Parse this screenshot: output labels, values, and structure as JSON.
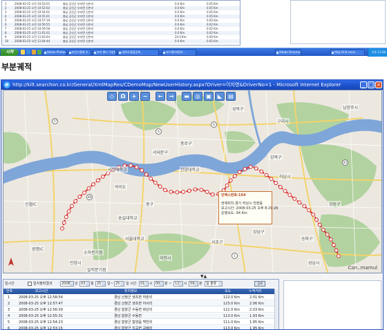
{
  "prev_screenshot": {
    "rows": [
      {
        "no": "1",
        "time": "2008-03-25 오전 10:52:01",
        "place": "충남 공산군 부리면 신촌리",
        "speed": "0.0 Km",
        "dist": "0.05 Km"
      },
      {
        "no": "2",
        "time": "2008-03-25 오전 10:52:03",
        "place": "충남 공산군 부리면 신촌리",
        "speed": "0.0 Km",
        "dist": "0.05 Km"
      },
      {
        "no": "3",
        "time": "2008-03-25 오전 10:54:01",
        "place": "충남 공산군 부리면 신촌리",
        "speed": "0.0 Km",
        "dist": "0.05 Km"
      },
      {
        "no": "4",
        "time": "2008-03-25 오전 10:55:01",
        "place": "충남 공산군 부리면 신촌리",
        "speed": "0.0 Km",
        "dist": "0.05 Km"
      },
      {
        "no": "5",
        "time": "2008-03-25 오전 10:57:19",
        "place": "충남 공산군 부리면 신촌리",
        "speed": "0.0 Km",
        "dist": "0.05 Km"
      },
      {
        "no": "6",
        "time": "2008-03-25 오전 10:56:55",
        "place": "충남 공산군 부리면 신촌리",
        "speed": "0.0 Km",
        "dist": "0.02 Km"
      },
      {
        "no": "7",
        "time": "2008-03-25 오전 10:59:58",
        "place": "충남 공산군 부리면 신촌리",
        "speed": "0.0 Km",
        "dist": "0.02 Km"
      },
      {
        "no": "8",
        "time": "2008-03-25 오전 11:01:01",
        "place": "충남 공산군 부리면 신촌리",
        "speed": "0.0 Km",
        "dist": "0.02 Km"
      },
      {
        "no": "9",
        "time": "2008-03-25 오전 11:03:44",
        "place": "충남 공산군 부리면 신촌리",
        "speed": "24.0 Km",
        "dist": "0.00 Km"
      },
      {
        "no": "10",
        "time": "2008-03-25 오전 11:04:44",
        "place": "충남 공산군 부리면 신촌리",
        "speed": "0.0 Km",
        "dist": "0.05 Km"
      }
    ],
    "taskbar": {
      "start": "시작",
      "tasks": [
        "Adobe Photosh...",
        "마인드맵에 오...",
        "프리 핸드 이상형...",
        "네이버 통합검색...",
        "코드웨어4정보...",
        "Adobe Dreamw...",
        "http://kilt.searc..."
      ],
      "clock": "오후 11:56"
    }
  },
  "section_heading": "부분궤적",
  "window": {
    "title": "http://kilt.searchon.co.kr/General/XmlMapRes/CDemoMap/NewUserHistory.aspx?Driver=이지영&DriverNo=1 - Microsoft Internet Explorer",
    "buttons": {
      "minimize": "_",
      "maximize": "□",
      "close": "×"
    }
  },
  "map": {
    "toolbar": [
      "◇",
      "Ω",
      "+",
      "−",
      "←",
      "→",
      "▬",
      "◎",
      "▣",
      "◣",
      "▤"
    ],
    "districts": [
      {
        "id": "gangbuk",
        "name": "강북구"
      },
      {
        "id": "dobong",
        "name": "성북구"
      },
      {
        "id": "seodaemun",
        "name": "서대문구"
      },
      {
        "id": "jongno",
        "name": "종로구"
      },
      {
        "id": "jung",
        "name": "중구"
      },
      {
        "id": "yeongdeungpo",
        "name": "여의도"
      },
      {
        "id": "gangnam",
        "name": "강남구"
      },
      {
        "id": "songpa",
        "name": "송파구"
      },
      {
        "id": "gangdong",
        "name": "강동구"
      },
      {
        "id": "guri",
        "name": "구리시"
      },
      {
        "id": "namyangju",
        "name": "남양주시"
      },
      {
        "id": "gwacheon",
        "name": "과천시"
      },
      {
        "id": "seongnam",
        "name": "성남시"
      },
      {
        "id": "hanam",
        "name": "하남시"
      },
      {
        "id": "seocho",
        "name": "서초구"
      },
      {
        "id": "anyang",
        "name": "안양시"
      },
      {
        "id": "hanyang",
        "name": "한양대학교"
      },
      {
        "id": "yonsei",
        "name": "서강대학교"
      },
      {
        "id": "soongsil",
        "name": "숭실대학교"
      },
      {
        "id": "seoul_univ",
        "name": "서울대학교"
      },
      {
        "id": "gimpo",
        "name": "신월IC"
      },
      {
        "id": "gongham",
        "name": "광명IC"
      },
      {
        "id": "sochon",
        "name": "소하분기점"
      },
      {
        "id": "ilsan",
        "name": "일직분기점"
      }
    ],
    "info_popup": {
      "title": "인덱스번호:154",
      "lines": [
        "현재위치:경기 하남시 천현동",
        "보고시간: 2008-03-25 오후 8:29:26",
        "운행속도: 94 Km"
      ]
    },
    "copyright": "Con..mamul",
    "expand_arrow": "▼▲"
  },
  "history": {
    "filter": {
      "label_start": "일시간",
      "checkbox_label": "일지출력결과",
      "year": "2008",
      "year_unit": "년",
      "month": "03",
      "month_unit": "월",
      "day": "25",
      "day_unit": "일",
      "to_label": "일~",
      "to_month": "25",
      "to_day_label": "일 시간",
      "hour1": "01",
      "hour1_unit": "시",
      "hour2": "00",
      "hour2_unit": "분 ~",
      "hour3": "12",
      "min3": "59",
      "min3_unit": "분",
      "mode": "일 분류",
      "search": "검색"
    },
    "columns": [
      "번호",
      "보고시간",
      "위치정보",
      "속도",
      "누적거리"
    ],
    "rows": [
      {
        "no": "1",
        "time": "2008-03-25 오후 12:58:54",
        "place": "경남 산청군 생초면 하촌리",
        "speed": "122.0 Km",
        "dist": "2.01 Km"
      },
      {
        "no": "2",
        "time": "2008-03-25 오후 12:57:47",
        "place": "경남 산청군 생초면 어서리",
        "speed": "123.0 Km",
        "dist": "2.06 Km"
      },
      {
        "no": "3",
        "time": "2008-03-25 오후 12:56:39",
        "place": "경남 함양군 수동면 화산리",
        "speed": "121.0 Km",
        "dist": "2.03 Km"
      },
      {
        "no": "4",
        "time": "2008-03-25 오후 12:55:31",
        "place": "경남 함양군 수동면",
        "speed": "113.0 Km",
        "dist": "1.93 Km"
      },
      {
        "no": "5",
        "time": "2008-03-25 오후 12:54:23",
        "place": "경남 함양군 함양읍 백천리",
        "speed": "111.0 Km",
        "dist": "1.95 Km"
      },
      {
        "no": "6",
        "time": "2008-03-25 오후 12:53:15",
        "place": "경남 함양군 지곡면 공배리",
        "speed": "113.0 Km",
        "dist": "1.95 Km"
      }
    ]
  },
  "colors": {
    "title_bar": "#1b4fc8",
    "river": "#7fa6d8",
    "route": "#d62b2b",
    "route_point": "#ffffff",
    "parks": "#a8cf95",
    "grid_header": "#24509c"
  }
}
